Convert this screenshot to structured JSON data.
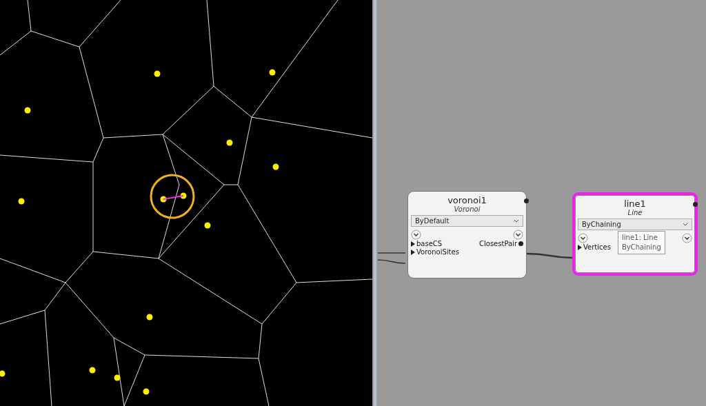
{
  "graph_nodes": [
    {
      "name": "voronoi1",
      "type": "Voronoi",
      "dropdown": "ByDefault",
      "inputs": [
        "baseCS",
        "VoronoiSites"
      ],
      "outputs": [
        "ClosestPair"
      ],
      "selected": false
    },
    {
      "name": "line1",
      "type": "Line",
      "dropdown": "ByChaining",
      "inputs": [
        "Vertices"
      ],
      "selected": true
    }
  ],
  "tooltip": {
    "lines": [
      "line1: Line",
      "ByChaining"
    ]
  }
}
